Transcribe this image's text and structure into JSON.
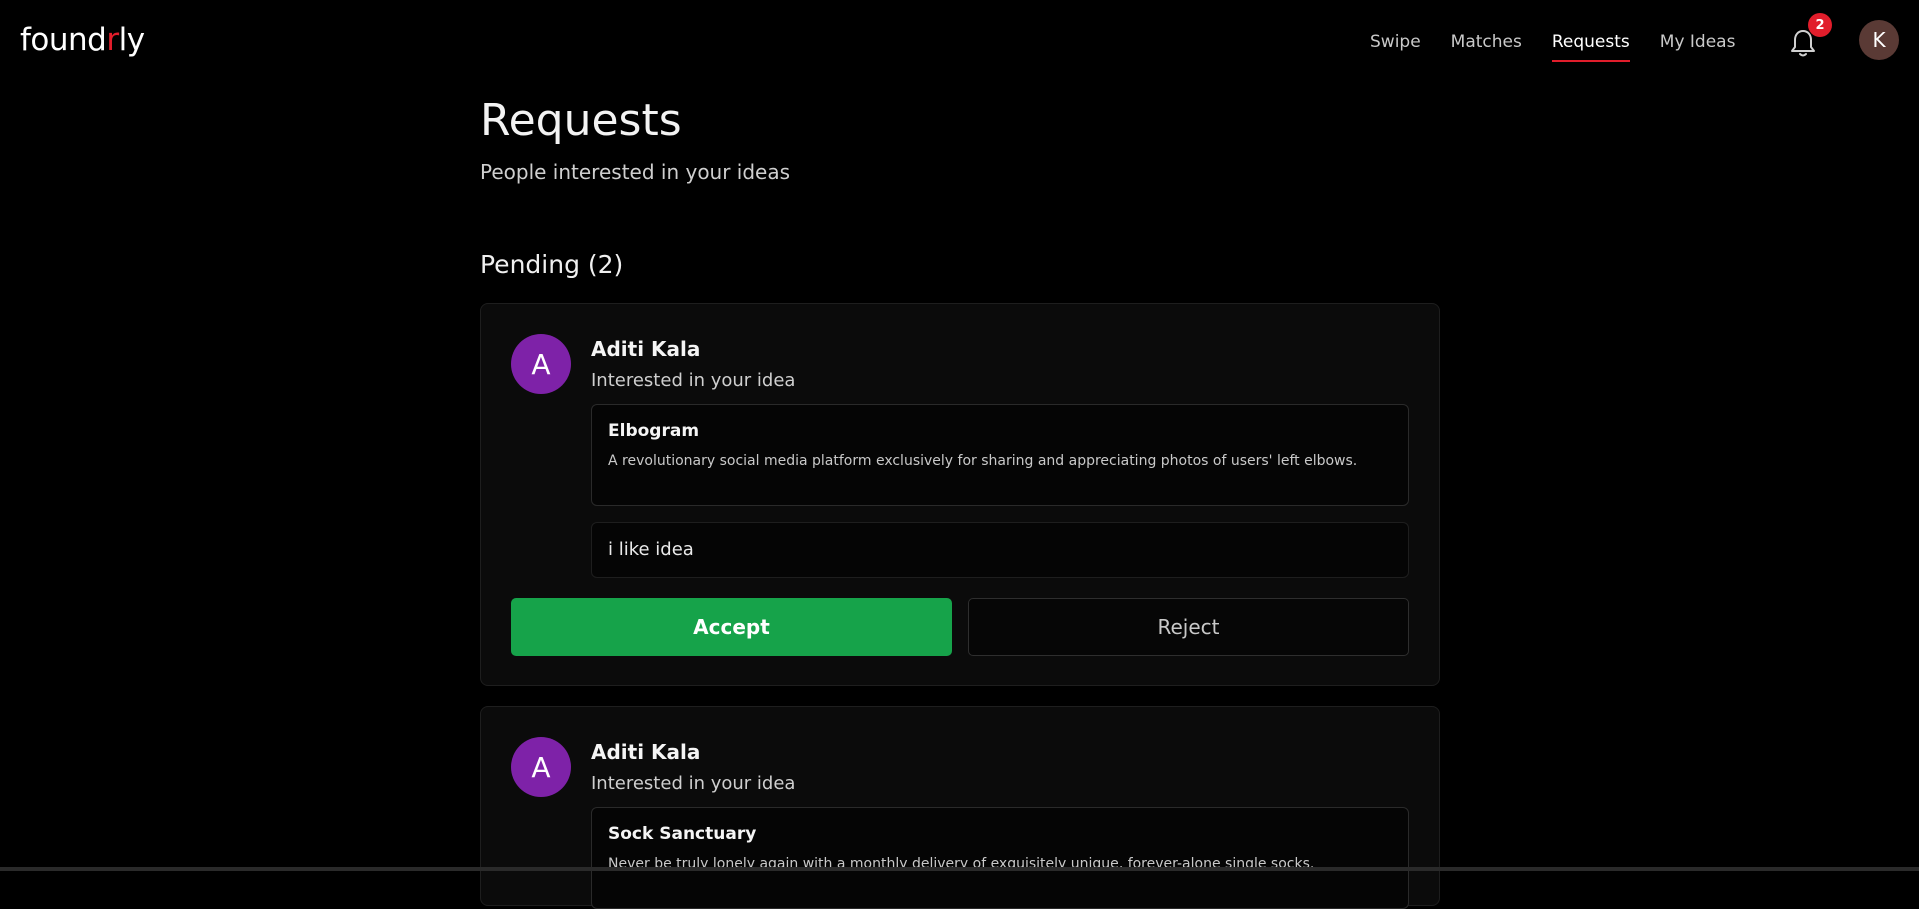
{
  "brand": {
    "name_start": "found",
    "name_accent": "r",
    "name_end": "ly",
    "accent_color": "#e11d2b"
  },
  "nav": {
    "items": [
      {
        "label": "Swipe",
        "active": false
      },
      {
        "label": "Matches",
        "active": false
      },
      {
        "label": "Requests",
        "active": true
      },
      {
        "label": "My Ideas",
        "active": false
      }
    ],
    "notifications_count": "2",
    "user_initial": "K"
  },
  "page": {
    "title": "Requests",
    "subtitle": "People interested in your ideas"
  },
  "pending": {
    "heading": "Pending (2)",
    "requests": [
      {
        "initial": "A",
        "name": "Aditi Kala",
        "subtitle": "Interested in your idea",
        "idea_title": "Elbogram",
        "idea_description": "A revolutionary social media platform exclusively for sharing and appreciating photos of users' left elbows.",
        "message": "i like idea",
        "accept_label": "Accept",
        "reject_label": "Reject"
      },
      {
        "initial": "A",
        "name": "Aditi Kala",
        "subtitle": "Interested in your idea",
        "idea_title": "Sock Sanctuary",
        "idea_description": "Never be truly lonely again with a monthly delivery of exquisitely unique, forever-alone single socks."
      }
    ]
  },
  "colors": {
    "accent_red": "#e11d2b",
    "accept_green": "#16a34a",
    "avatar_purple": "#7e22a8"
  }
}
